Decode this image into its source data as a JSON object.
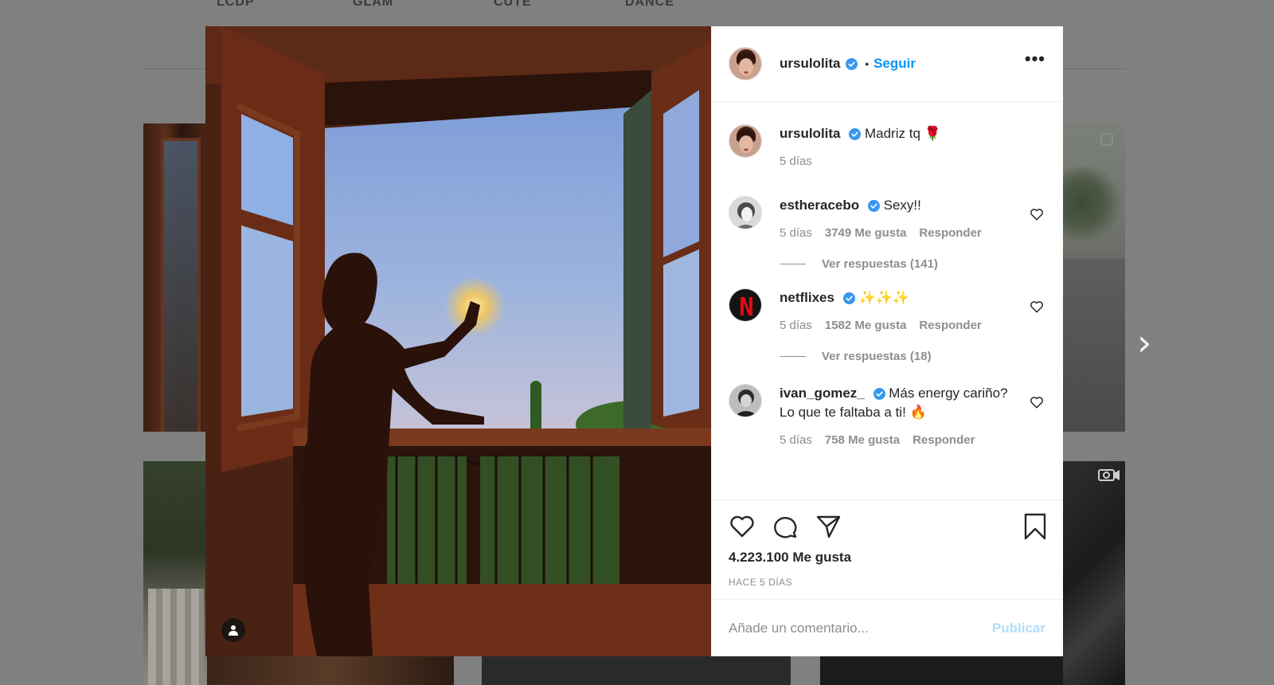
{
  "background": {
    "highlights": [
      "LCDP",
      "GLAM",
      "CUTE",
      "DANCE"
    ]
  },
  "post": {
    "author": {
      "username": "ursulolita",
      "verified": true,
      "follow_label": "Seguir",
      "more_label": "•••"
    },
    "caption": {
      "username": "ursulolita",
      "text": "Madriz tq 🌹",
      "time": "5 días"
    },
    "comments": [
      {
        "username": "estheracebo",
        "verified": true,
        "text": "Sexy!!",
        "time": "5 días",
        "likes": "3749 Me gusta",
        "reply_label": "Responder",
        "view_replies": "Ver respuestas (141)"
      },
      {
        "username": "netflixes",
        "verified": true,
        "text": "✨✨✨",
        "time": "5 días",
        "likes": "1582 Me gusta",
        "reply_label": "Responder",
        "view_replies": "Ver respuestas (18)"
      },
      {
        "username": "ivan_gomez_",
        "verified": true,
        "text": "Más energy cariño? Lo que te faltaba a ti! 🔥",
        "time": "5 días",
        "likes": "758 Me gusta",
        "reply_label": "Responder"
      }
    ],
    "likes_total": "4.223.100 Me gusta",
    "posted_ago": "HACE 5 DÍAS",
    "comment_placeholder": "Añade un comentario...",
    "publish_label": "Publicar"
  },
  "colors": {
    "link_blue": "#0095f6",
    "publish_disabled": "#b2dffc",
    "verified_blue": "#3897f0"
  },
  "icons": [
    "heart-icon",
    "comment-icon",
    "share-icon",
    "bookmark-icon",
    "user-tag-icon",
    "chevron-right-icon",
    "verified-badge-icon",
    "more-options-icon"
  ]
}
